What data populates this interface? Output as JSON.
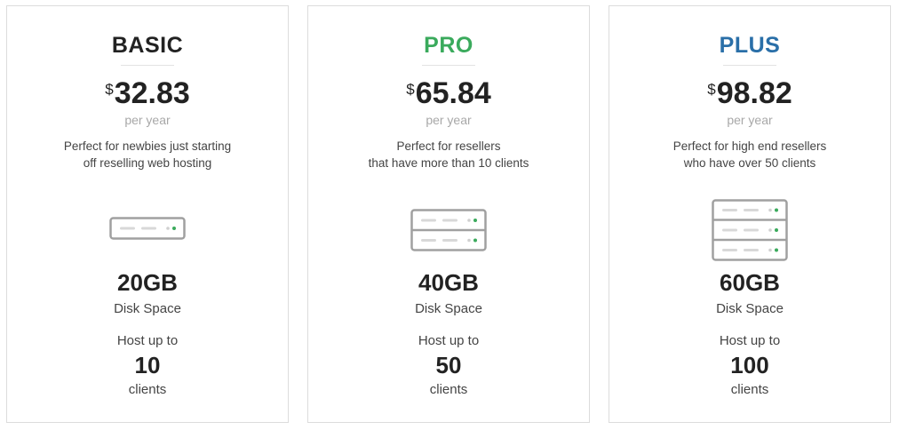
{
  "plans": [
    {
      "name": "BASIC",
      "name_color": "#222222",
      "currency": "$",
      "price": "32.83",
      "period": "per year",
      "description_line1": "Perfect for newbies just starting",
      "description_line2": "off reselling web hosting",
      "icon": "server-1-unit-icon",
      "disk_value": "20GB",
      "disk_label": "Disk Space",
      "host_label": "Host up to",
      "clients_value": "10",
      "clients_label": "clients"
    },
    {
      "name": "PRO",
      "name_color": "#3aaa5c",
      "currency": "$",
      "price": "65.84",
      "period": "per year",
      "description_line1": "Perfect for resellers",
      "description_line2": "that have more than 10 clients",
      "icon": "server-2-unit-icon",
      "disk_value": "40GB",
      "disk_label": "Disk Space",
      "host_label": "Host up to",
      "clients_value": "50",
      "clients_label": "clients"
    },
    {
      "name": "PLUS",
      "name_color": "#2a6fa8",
      "currency": "$",
      "price": "98.82",
      "period": "per year",
      "description_line1": "Perfect for high end resellers",
      "description_line2": "who have over 50 clients",
      "icon": "server-3-unit-icon",
      "disk_value": "60GB",
      "disk_label": "Disk Space",
      "host_label": "Host up to",
      "clients_value": "100",
      "clients_label": "clients"
    }
  ],
  "colors": {
    "border": "#dcdcdc",
    "muted_text": "#a8a8a8",
    "server_stroke": "#a0a0a0",
    "server_bar": "#d8d8d8",
    "server_led": "#3aaa5c"
  }
}
